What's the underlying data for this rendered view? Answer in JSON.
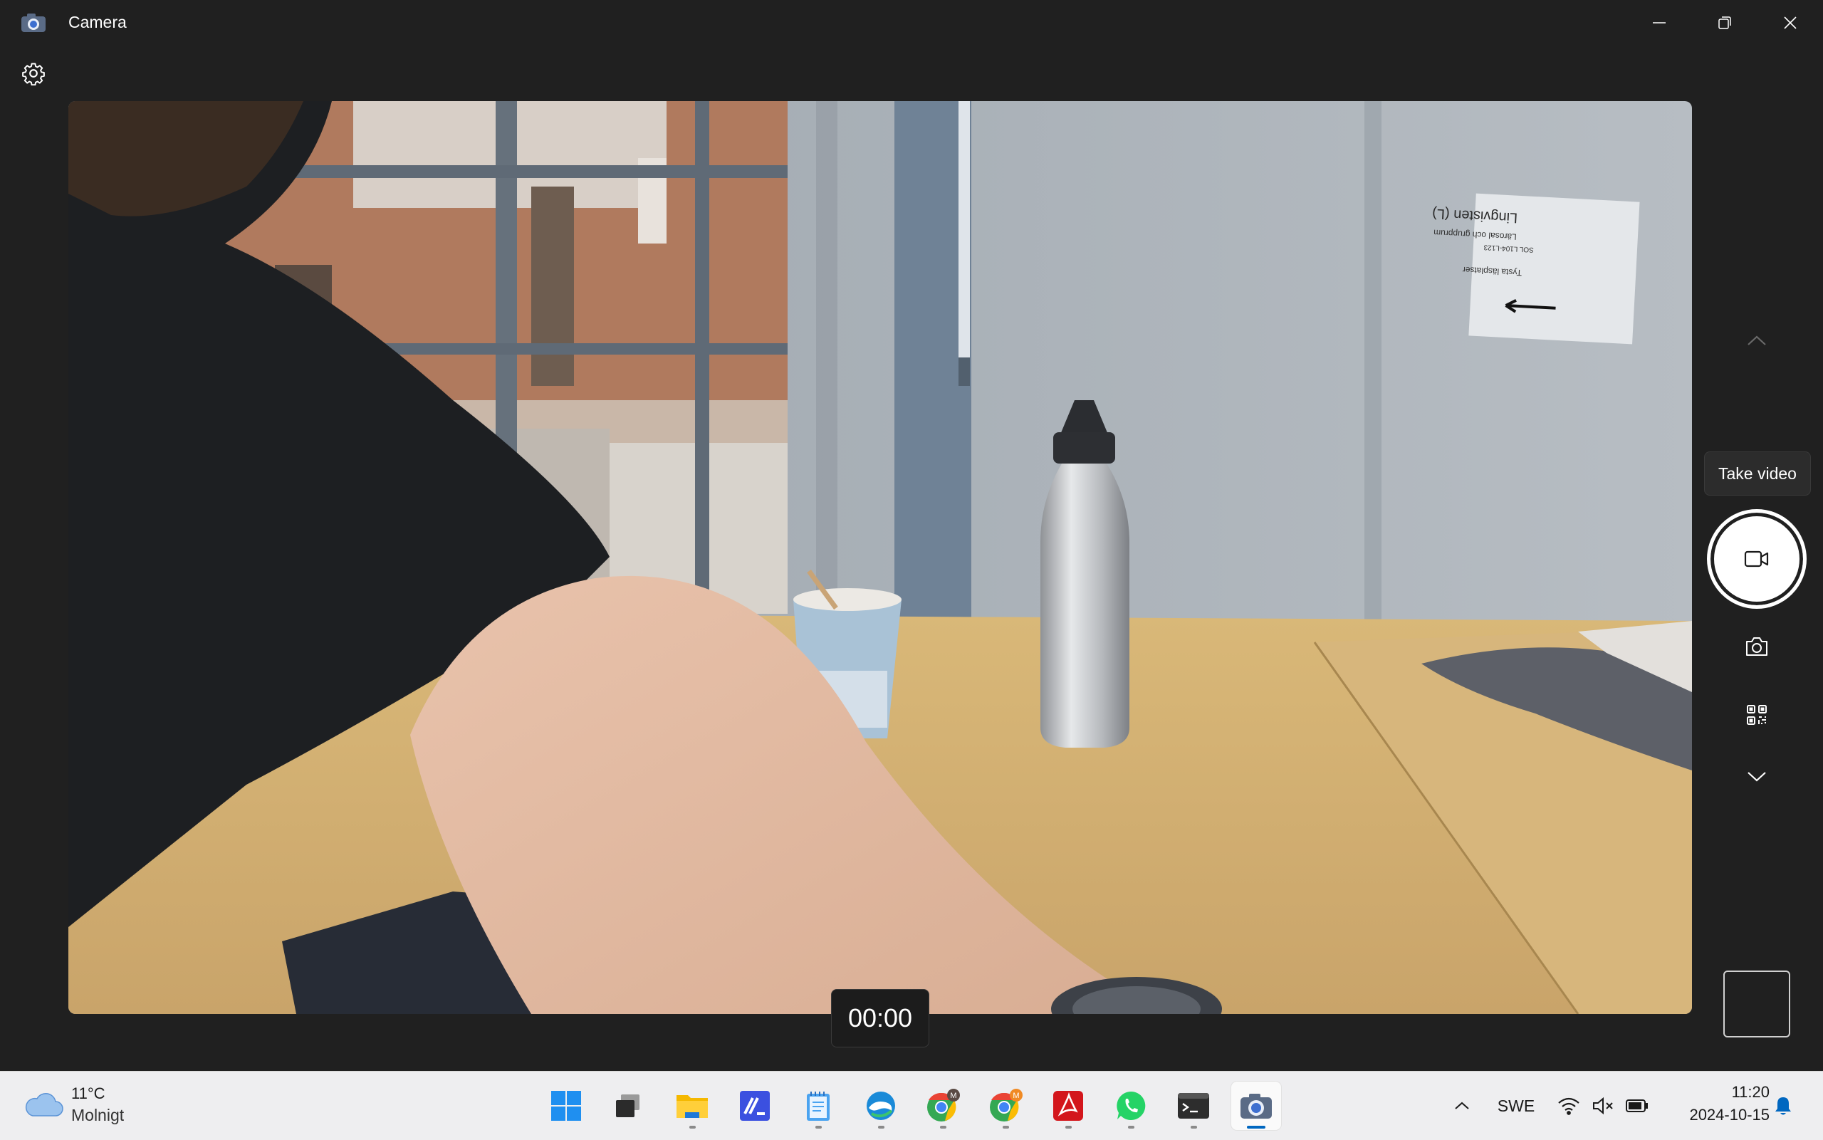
{
  "window": {
    "title": "Camera",
    "icon": "camera-app-icon",
    "controls": [
      "minimize-icon",
      "maximize-icon",
      "close-icon"
    ]
  },
  "toolbar": {
    "settings_icon": "gear-icon"
  },
  "preview": {
    "sign": {
      "line1": "Lingvisten (L)",
      "line2": "Lärosal och grupprum",
      "line3": "SOL L104-L123",
      "line4": "Tysta läsplatser"
    }
  },
  "recording": {
    "timer": "00:00"
  },
  "controls": {
    "tooltip": "Take video",
    "items": [
      "chevron-up-icon",
      "video-camera-icon",
      "photo-camera-icon",
      "qr-code-icon",
      "chevron-down-icon"
    ]
  },
  "taskbar": {
    "weather": {
      "temp": "11°C",
      "desc": "Molnigt",
      "icon": "cloud-icon"
    },
    "apps": [
      "windows-start",
      "task-view",
      "file-explorer",
      "visual-studio",
      "notepad",
      "edge-browser",
      "chrome-profile-1",
      "chrome-profile-2",
      "adobe-acrobat",
      "whatsapp",
      "terminal",
      "camera"
    ],
    "tray": {
      "language": "SWE",
      "icons": [
        "chevron-up-icon",
        "wifi-icon",
        "speaker-muted-icon",
        "battery-icon",
        "bell-icon"
      ]
    },
    "clock": {
      "time": "11:20",
      "date": "2024-10-15"
    }
  },
  "colors": {
    "accent": "#0067c0",
    "titlebar": "#202020",
    "taskbar": "#eeeef0"
  }
}
